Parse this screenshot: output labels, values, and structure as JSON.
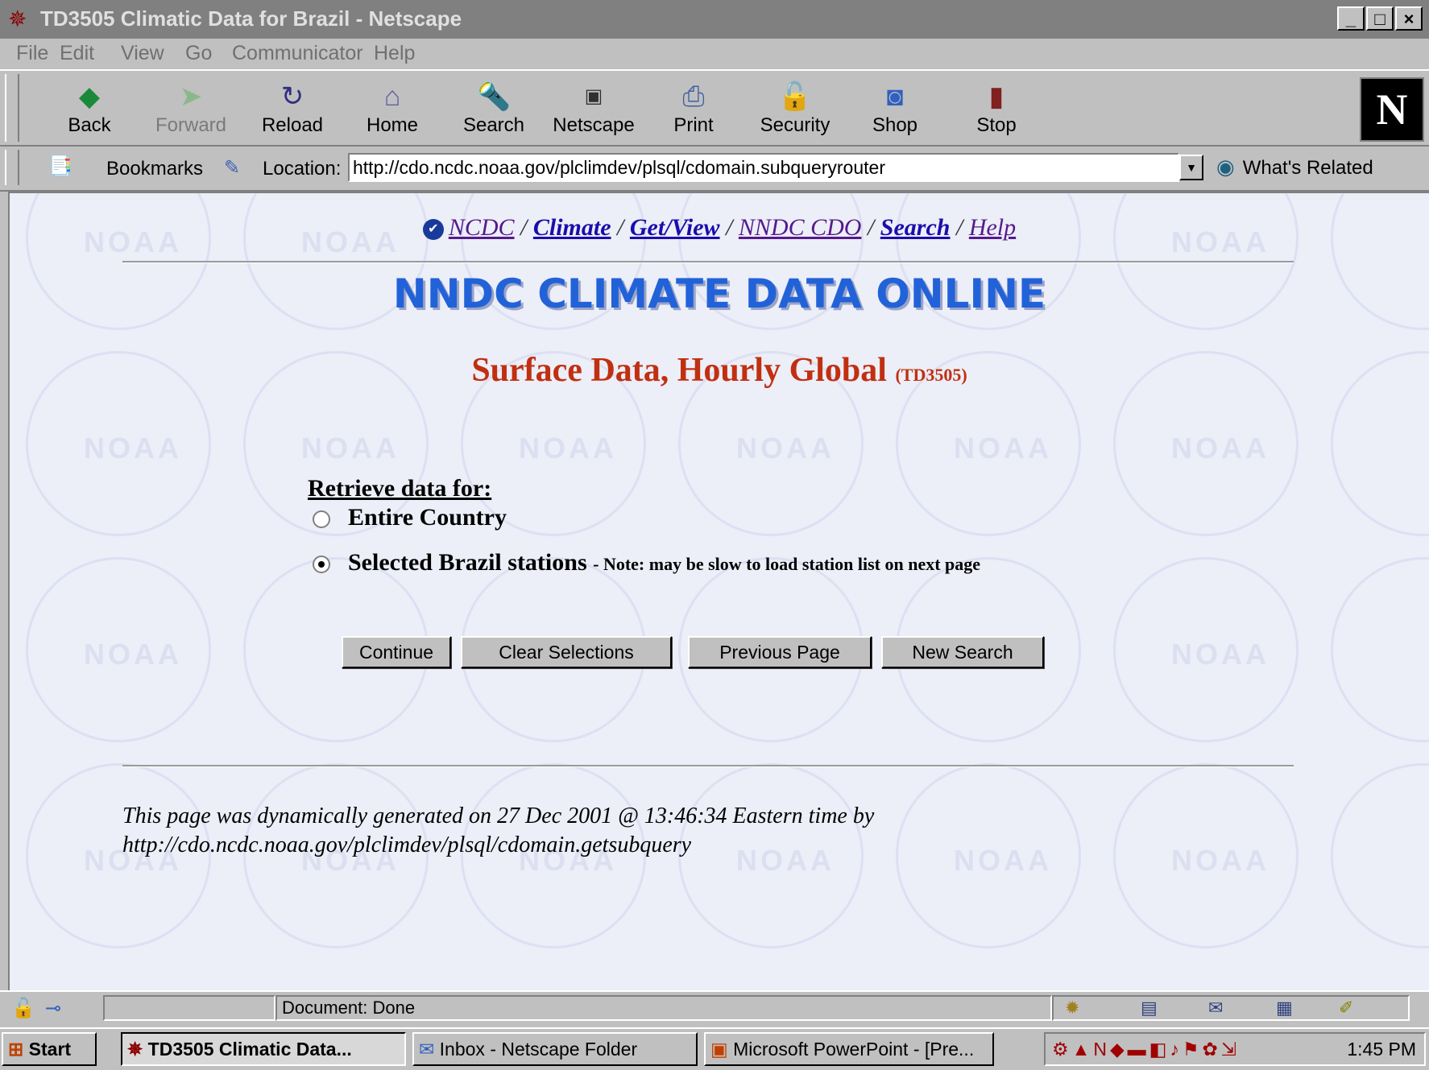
{
  "window": {
    "title": "TD3505 Climatic Data for Brazil - Netscape",
    "controls": [
      "_",
      "□",
      "×"
    ]
  },
  "menu": [
    "File",
    "Edit",
    "View",
    "Go",
    "Communicator",
    "Help"
  ],
  "toolbar": {
    "buttons": [
      {
        "label": "Back",
        "icon": "back-arrow-icon"
      },
      {
        "label": "Forward",
        "icon": "forward-arrow-icon",
        "disabled": true
      },
      {
        "label": "Reload",
        "icon": "reload-icon"
      },
      {
        "label": "Home",
        "icon": "home-icon"
      },
      {
        "label": "Search",
        "icon": "search-icon"
      },
      {
        "label": "Netscape",
        "icon": "my-netscape-icon"
      },
      {
        "label": "Print",
        "icon": "printer-icon"
      },
      {
        "label": "Security",
        "icon": "padlock-icon"
      },
      {
        "label": "Shop",
        "icon": "shop-icon"
      },
      {
        "label": "Stop",
        "icon": "stop-light-icon"
      }
    ],
    "logo": "N"
  },
  "location": {
    "bookmarks_label": "Bookmarks",
    "location_label": "Location:",
    "url": "http://cdo.ncdc.noaa.gov/plclimdev/plsql/cdomain.subqueryrouter",
    "related_label": "What's Related"
  },
  "page": {
    "breadcrumbs": [
      "NCDC",
      "Climate",
      "Get/View",
      "NNDC CDO",
      "Search",
      "Help"
    ],
    "separator": "/",
    "heading": "NNDC CLIMATE DATA ONLINE",
    "subheading": "Surface Data, Hourly Global",
    "subheading_code": "(TD3505)",
    "retrieve_label": "Retrieve data for:",
    "options": [
      {
        "label": "Entire Country",
        "selected": false
      },
      {
        "label": "Selected Brazil stations",
        "selected": true,
        "note": "- Note: may be slow to load station list on next page"
      }
    ],
    "buttons": [
      "Continue",
      "Clear Selections",
      "Previous Page",
      "New Search"
    ],
    "footer_line1": "This page was dynamically generated on 27 Dec 2001 @ 13:46:34 Eastern time by",
    "footer_line2": "http://cdo.ncdc.noaa.gov/plclimdev/plsql/cdomain.getsubquery",
    "watermark_text": "NOAA"
  },
  "status": {
    "text": "Document: Done"
  },
  "taskbar": {
    "start": "Start",
    "items": [
      {
        "label": "TD3505 Climatic Data...",
        "active": true
      },
      {
        "label": "Inbox - Netscape Folder",
        "active": false
      },
      {
        "label": "Microsoft PowerPoint - [Pre...",
        "active": false
      }
    ],
    "clock": "1:45 PM"
  },
  "colors": {
    "heading": "#2262d8",
    "subheading": "#c03010",
    "link": "#1a0dab",
    "visited_link": "#551a8b",
    "page_bg": "#eceef8"
  }
}
